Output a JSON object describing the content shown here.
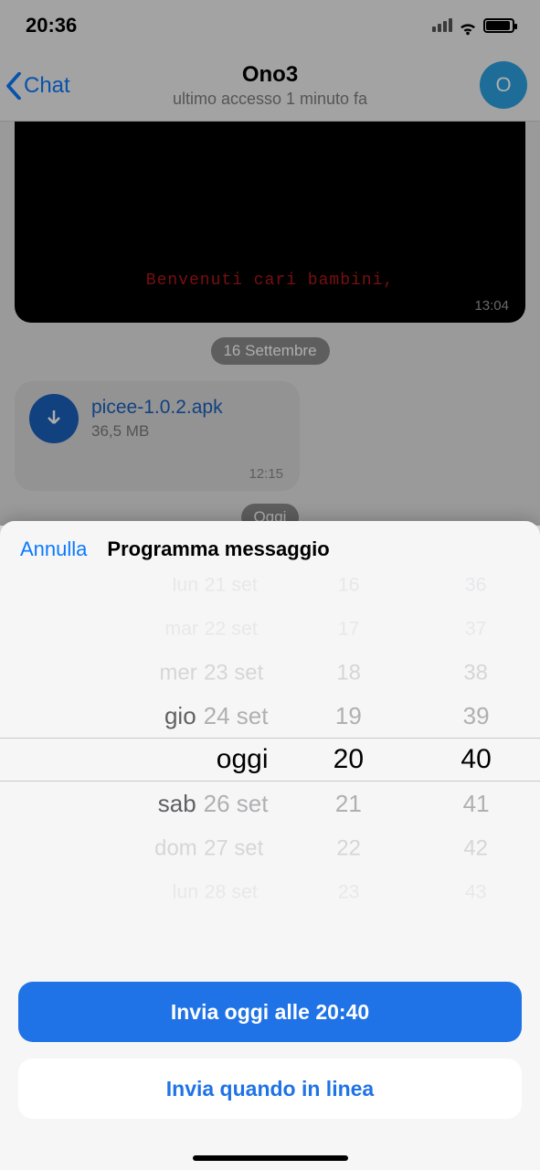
{
  "status": {
    "time": "20:36"
  },
  "nav": {
    "back_label": "Chat",
    "title": "Ono3",
    "subtitle": "ultimo accesso 1 minuto fa",
    "avatar_initial": "O"
  },
  "msg_dark": {
    "text": "Benvenuti  cari  bambini,",
    "time": "13:04"
  },
  "date_pill_1": "16 Settembre",
  "file": {
    "name": "picee-1.0.2.apk",
    "size": "36,5 MB",
    "time": "12:15"
  },
  "date_pill_today": "Oggi",
  "sheet": {
    "cancel": "Annulla",
    "title": "Programma messaggio",
    "date_rows": [
      {
        "day": "lun",
        "rest": "21 set",
        "cls": "vfaint"
      },
      {
        "day": "mar",
        "rest": "22 set",
        "cls": "vfaint"
      },
      {
        "day": "mer",
        "rest": "23 set",
        "cls": "faint"
      },
      {
        "day": "gio",
        "rest": "24 set",
        "cls": ""
      },
      {
        "day": "",
        "rest": "oggi",
        "cls": "sel"
      },
      {
        "day": "sab",
        "rest": "26 set",
        "cls": ""
      },
      {
        "day": "dom",
        "rest": "27 set",
        "cls": "faint"
      },
      {
        "day": "lun",
        "rest": "28 set",
        "cls": "vfaint"
      }
    ],
    "hour_rows": [
      {
        "v": "16",
        "cls": "vfaint"
      },
      {
        "v": "17",
        "cls": "vfaint"
      },
      {
        "v": "18",
        "cls": "faint"
      },
      {
        "v": "19",
        "cls": ""
      },
      {
        "v": "20",
        "cls": "sel"
      },
      {
        "v": "21",
        "cls": ""
      },
      {
        "v": "22",
        "cls": "faint"
      },
      {
        "v": "23",
        "cls": "vfaint"
      }
    ],
    "minute_rows": [
      {
        "v": "36",
        "cls": "vfaint"
      },
      {
        "v": "37",
        "cls": "vfaint"
      },
      {
        "v": "38",
        "cls": "faint"
      },
      {
        "v": "39",
        "cls": ""
      },
      {
        "v": "40",
        "cls": "sel"
      },
      {
        "v": "41",
        "cls": ""
      },
      {
        "v": "42",
        "cls": "faint"
      },
      {
        "v": "43",
        "cls": "vfaint"
      }
    ],
    "primary_button": "Invia oggi alle 20:40",
    "secondary_button": "Invia quando in linea"
  }
}
